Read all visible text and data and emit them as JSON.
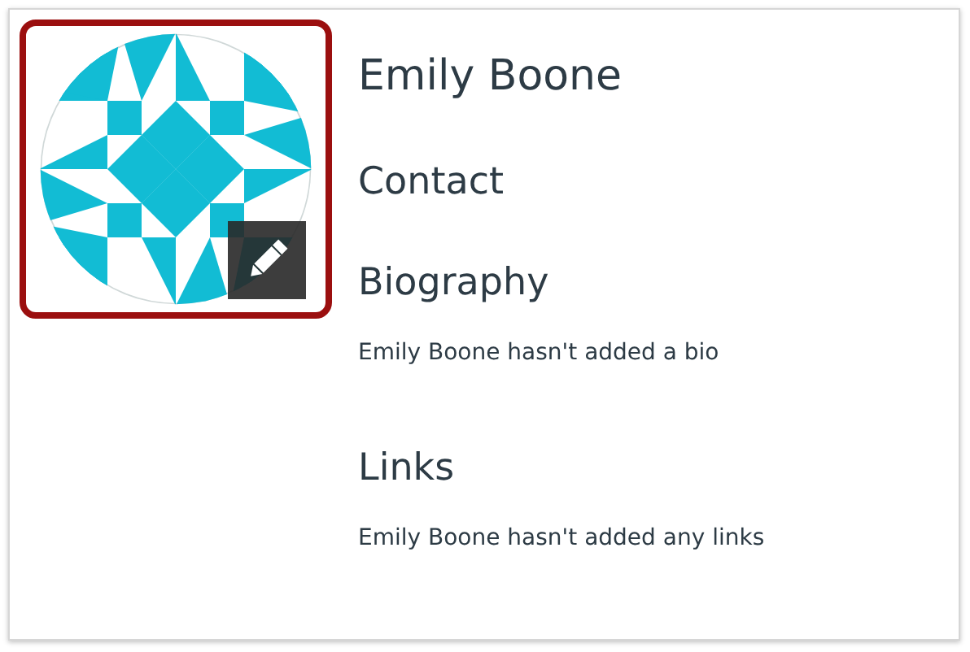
{
  "profile": {
    "avatar": {
      "highlighted": true
    },
    "name": "Emily Boone",
    "contact_heading": "Contact",
    "sections": [
      {
        "heading": "Biography",
        "note": "Emily Boone hasn't added a bio"
      },
      {
        "heading": "Links",
        "note": "Emily Boone hasn't added any links"
      }
    ]
  }
}
